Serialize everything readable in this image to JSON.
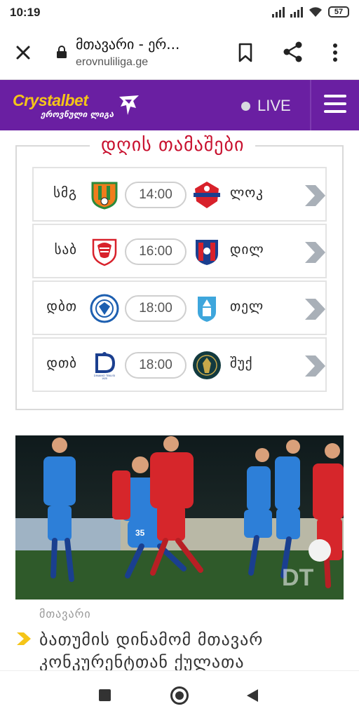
{
  "status_bar": {
    "time": "10:19",
    "battery": "57"
  },
  "browser": {
    "page_title": "მთავარი - ერ...",
    "url": "erovnuliliga.ge"
  },
  "site_header": {
    "brand": "Crystalbet",
    "brand_sub": "ეროვნული ლიგა",
    "live_label": "LIVE",
    "colors": {
      "primary": "#6a1fa2",
      "brand_yellow": "#f5c518"
    }
  },
  "matches": {
    "title": "დღის თამაშები",
    "rows": [
      {
        "home": "სმგ",
        "time": "14:00",
        "away": "ლოკ"
      },
      {
        "home": "საბ",
        "time": "16:00",
        "away": "დილ"
      },
      {
        "home": "დბთ",
        "time": "18:00",
        "away": "თელ"
      },
      {
        "home": "დთბ",
        "time": "18:00",
        "away": "შუქ"
      }
    ]
  },
  "news": {
    "category": "მთავარი",
    "headline": "ბათუმის დინამომ მთავარ კონკურენტთან ქულათა",
    "image_text": {
      "player_number": "35",
      "crest_mark": "DT",
      "crest_name": "DINAMO TBILISI",
      "crest_year": "1925"
    }
  }
}
